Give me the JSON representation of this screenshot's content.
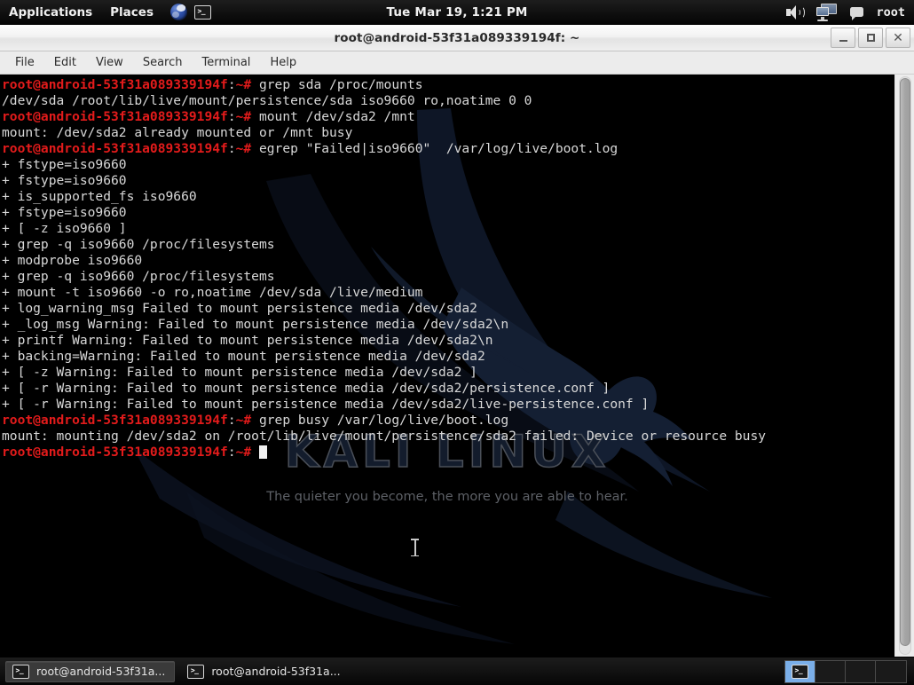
{
  "top_panel": {
    "applications_label": "Applications",
    "places_label": "Places",
    "launchers": [
      {
        "name": "web-browser-icon",
        "label": "Web Browser"
      },
      {
        "name": "terminal-icon",
        "label": "Terminal"
      }
    ],
    "clock": "Tue Mar 19,  1:21 PM",
    "volume_icon": "speaker-icon",
    "display_icon": "displays-icon",
    "messages_icon": "chat-bubble-icon",
    "user": "root"
  },
  "window": {
    "title": "root@android-53f31a089339194f: ~",
    "buttons": {
      "minimize": "_",
      "maximize": "□",
      "close": "×"
    },
    "menus": [
      "File",
      "Edit",
      "View",
      "Search",
      "Terminal",
      "Help"
    ]
  },
  "terminal": {
    "prompt_user_host": "root@android-53f31a089339194f",
    "prompt_path": "~#",
    "watermark_title": "KALI LINUX",
    "watermark_tagline": "The quieter you become, the more you are able to hear.",
    "cursor": "block",
    "lines": [
      {
        "type": "prompt",
        "command": "grep sda /proc/mounts"
      },
      {
        "type": "output",
        "text": "/dev/sda /root/lib/live/mount/persistence/sda iso9660 ro,noatime 0 0"
      },
      {
        "type": "prompt",
        "command": "mount /dev/sda2 /mnt"
      },
      {
        "type": "output",
        "text": "mount: /dev/sda2 already mounted or /mnt busy"
      },
      {
        "type": "prompt",
        "command": "egrep \"Failed|iso9660\"  /var/log/live/boot.log"
      },
      {
        "type": "output",
        "text": "+ fstype=iso9660"
      },
      {
        "type": "output",
        "text": "+ fstype=iso9660"
      },
      {
        "type": "output",
        "text": "+ is_supported_fs iso9660"
      },
      {
        "type": "output",
        "text": "+ fstype=iso9660"
      },
      {
        "type": "output",
        "text": "+ [ -z iso9660 ]"
      },
      {
        "type": "output",
        "text": "+ grep -q iso9660 /proc/filesystems"
      },
      {
        "type": "output",
        "text": "+ modprobe iso9660"
      },
      {
        "type": "output",
        "text": "+ grep -q iso9660 /proc/filesystems"
      },
      {
        "type": "output",
        "text": "+ mount -t iso9660 -o ro,noatime /dev/sda /live/medium"
      },
      {
        "type": "output",
        "text": "+ log_warning_msg Failed to mount persistence media /dev/sda2"
      },
      {
        "type": "output",
        "text": "+ _log_msg Warning: Failed to mount persistence media /dev/sda2\\n"
      },
      {
        "type": "output",
        "text": "+ printf Warning: Failed to mount persistence media /dev/sda2\\n"
      },
      {
        "type": "output",
        "text": "+ backing=Warning: Failed to mount persistence media /dev/sda2"
      },
      {
        "type": "output",
        "text": "+ [ -z Warning: Failed to mount persistence media /dev/sda2 ]"
      },
      {
        "type": "output",
        "text": "+ [ -r Warning: Failed to mount persistence media /dev/sda2/persistence.conf ]"
      },
      {
        "type": "output",
        "text": "+ [ -r Warning: Failed to mount persistence media /dev/sda2/live-persistence.conf ]"
      },
      {
        "type": "prompt",
        "command": "grep busy /var/log/live/boot.log"
      },
      {
        "type": "output",
        "text": "mount: mounting /dev/sda2 on /root/lib/live/mount/persistence/sda2 failed: Device or resource busy"
      },
      {
        "type": "prompt",
        "command": ""
      }
    ]
  },
  "bottom_panel": {
    "tasks": [
      {
        "label": "root@android-53f31a...",
        "icon": "terminal-icon",
        "active": true
      },
      {
        "label": "root@android-53f31a...",
        "icon": "terminal-icon",
        "active": false
      }
    ],
    "workspaces": [
      {
        "index": 1,
        "active": true,
        "has_window": true
      },
      {
        "index": 2,
        "active": false,
        "has_window": false
      },
      {
        "index": 3,
        "active": false,
        "has_window": false
      },
      {
        "index": 4,
        "active": false,
        "has_window": false
      }
    ]
  },
  "colors": {
    "prompt_red": "#e21b1b",
    "terminal_fg": "#d6d6d6",
    "terminal_bg": "#000000",
    "panel_bg": "#111111",
    "workspace_active": "#7aaee8"
  }
}
